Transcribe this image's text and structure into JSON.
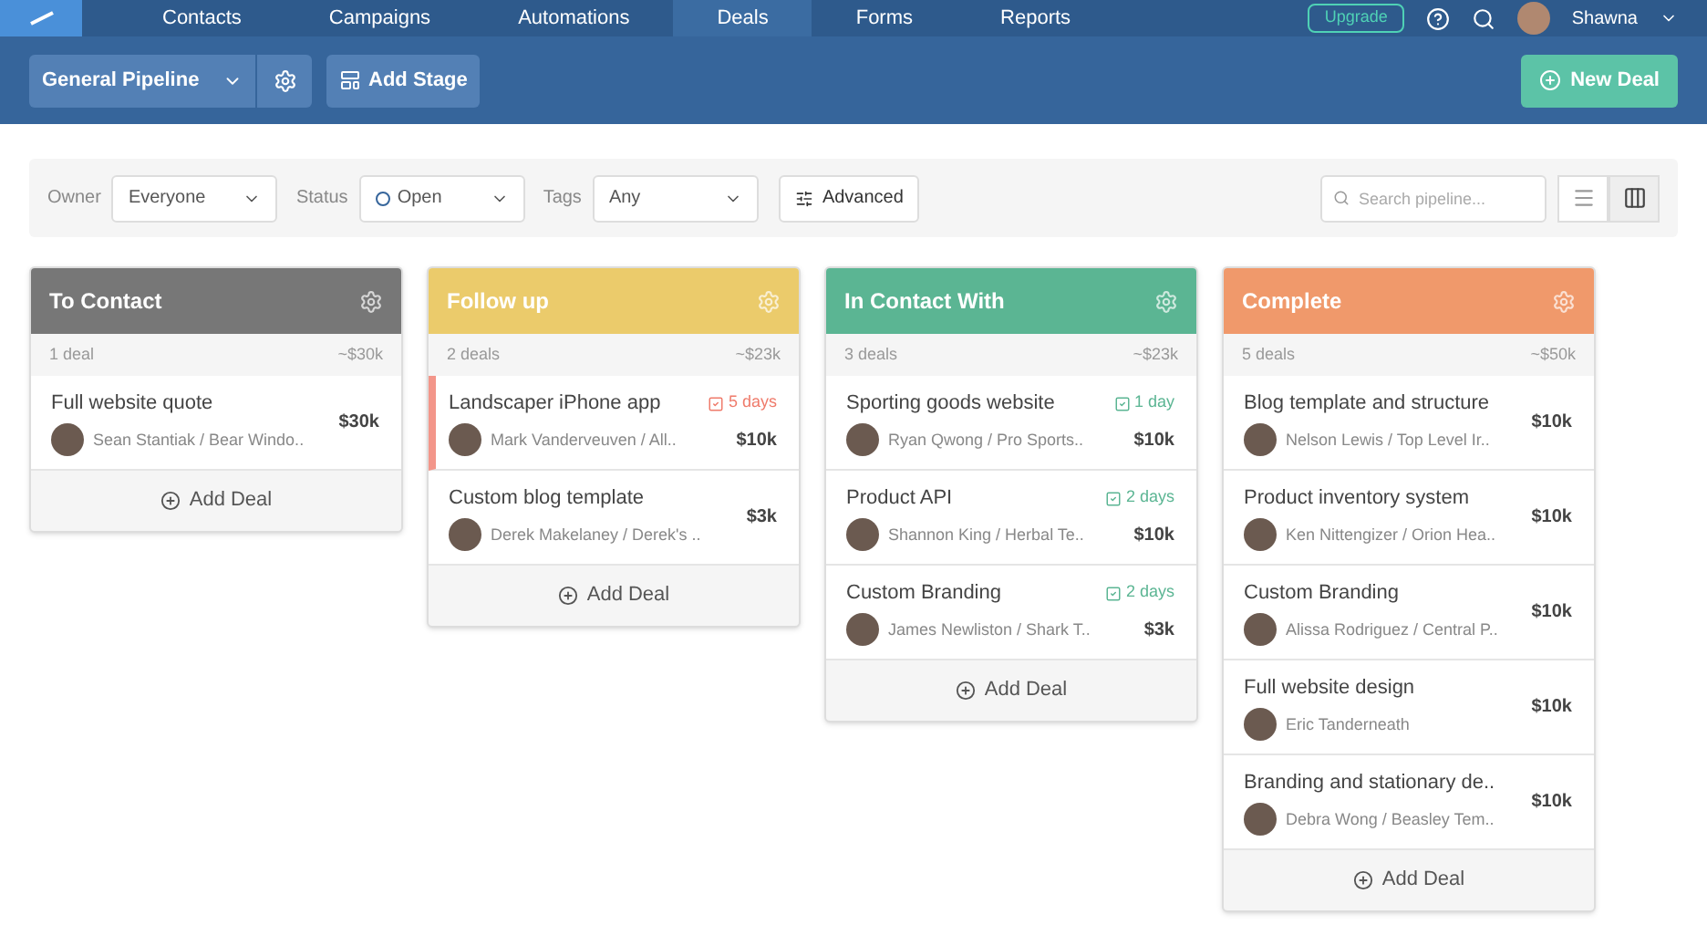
{
  "nav": {
    "items": [
      {
        "label": "Contacts",
        "selected": false
      },
      {
        "label": "Campaigns",
        "selected": false
      },
      {
        "label": "Automations",
        "selected": false
      },
      {
        "label": "Deals",
        "selected": true
      },
      {
        "label": "Forms",
        "selected": false
      },
      {
        "label": "Reports",
        "selected": false
      }
    ],
    "upgrade": "Upgrade",
    "user": "Shawna"
  },
  "toolbar": {
    "pipeline": "General Pipeline",
    "add_stage": "Add Stage",
    "new_deal": "New Deal"
  },
  "filters": {
    "owner_label": "Owner",
    "owner": "Everyone",
    "status_label": "Status",
    "status": "Open",
    "tags_label": "Tags",
    "tags": "Any",
    "advanced": "Advanced",
    "search_placeholder": "Search pipeline...",
    "views": [
      {
        "kind": "list",
        "selected": false
      },
      {
        "kind": "board",
        "selected": true
      }
    ]
  },
  "stages": [
    {
      "name": "To Contact",
      "color": "#777777",
      "count": "1 deal",
      "total": "~$30k",
      "add": "Add Deal",
      "deals": [
        {
          "title": "Full website quote",
          "contact": "Sean Stantiak / Bear Windo..",
          "value": "$30k",
          "flagged": false
        }
      ]
    },
    {
      "name": "Follow up",
      "color": "#ebcb6b",
      "count": "2 deals",
      "total": "~$23k",
      "add": "Add Deal",
      "deals": [
        {
          "title": "Landscaper iPhone app",
          "contact": "Mark Vanderveuven / All..",
          "value": "$10k",
          "flagged": true,
          "due": {
            "text": "5 days",
            "overdue": true
          }
        },
        {
          "title": "Custom blog template",
          "contact": "Derek Makelaney / Derek's ..",
          "value": "$3k",
          "flagged": false
        }
      ]
    },
    {
      "name": "In Contact With",
      "color": "#5bb593",
      "count": "3 deals",
      "total": "~$23k",
      "add": "Add Deal",
      "deals": [
        {
          "title": "Sporting goods website",
          "contact": "Ryan Qwong / Pro Sports..",
          "value": "$10k",
          "flagged": false,
          "due": {
            "text": "1 day",
            "overdue": false
          }
        },
        {
          "title": "Product API",
          "contact": "Shannon King / Herbal Te..",
          "value": "$10k",
          "flagged": false,
          "due": {
            "text": "2 days",
            "overdue": false
          }
        },
        {
          "title": "Custom Branding",
          "contact": "James Newliston / Shark T..",
          "value": "$3k",
          "flagged": false,
          "due": {
            "text": "2 days",
            "overdue": false
          }
        }
      ]
    },
    {
      "name": "Complete",
      "color": "#f0996b",
      "count": "5 deals",
      "total": "~$50k",
      "add": "Add Deal",
      "deals": [
        {
          "title": "Blog template and structure",
          "contact": "Nelson Lewis / Top Level Ir..",
          "value": "$10k",
          "flagged": false
        },
        {
          "title": "Product inventory system",
          "contact": "Ken Nittengizer / Orion Hea..",
          "value": "$10k",
          "flagged": false
        },
        {
          "title": "Custom Branding",
          "contact": "Alissa Rodriguez / Central P..",
          "value": "$10k",
          "flagged": false
        },
        {
          "title": "Full website design",
          "contact": "Eric Tanderneath",
          "value": "$10k",
          "flagged": false
        },
        {
          "title": "Branding and stationary de..",
          "contact": "Debra Wong / Beasley Tem..",
          "value": "$10k",
          "flagged": false
        }
      ]
    }
  ]
}
